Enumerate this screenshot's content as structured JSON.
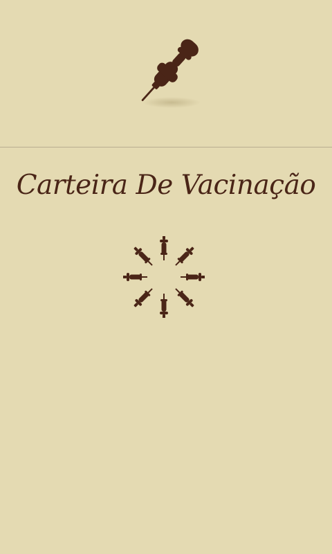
{
  "app": {
    "title": "Carteira De Vacinação"
  },
  "icons": {
    "logo": "syringe-icon",
    "loading": "syringe-loading-spinner"
  },
  "colors": {
    "background": "#e4dab2",
    "accent": "#4a2517",
    "divider": "#b8ad90"
  }
}
